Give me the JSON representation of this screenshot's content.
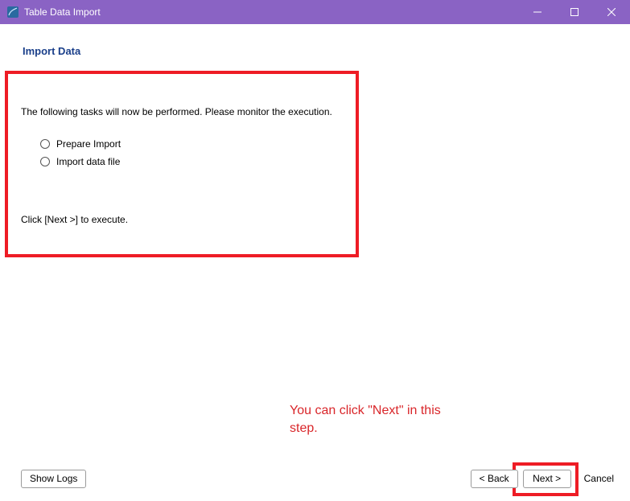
{
  "window": {
    "title": "Table Data Import"
  },
  "page": {
    "heading": "Import Data",
    "instruction_top": "The following tasks will now be performed. Please monitor the execution.",
    "tasks": [
      "Prepare Import",
      "Import data file"
    ],
    "instruction_bottom": "Click [Next >] to execute."
  },
  "annotation": {
    "text": "You can click \"Next\" in this step."
  },
  "footer": {
    "show_logs": "Show Logs",
    "back": "< Back",
    "next": "Next >",
    "cancel": "Cancel"
  }
}
